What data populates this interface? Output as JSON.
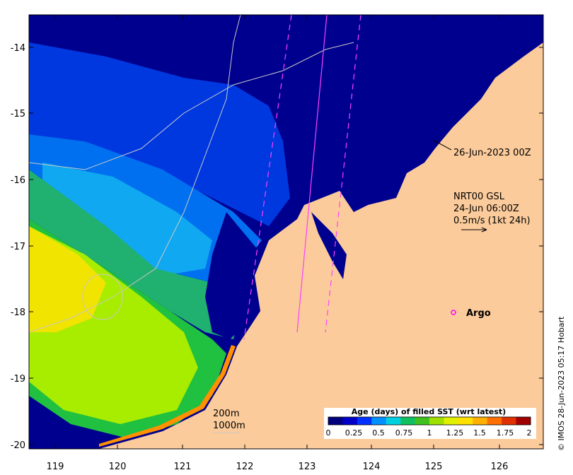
{
  "axes": {
    "x_ticks": [
      "119",
      "120",
      "121",
      "122",
      "123",
      "124",
      "125",
      "126"
    ],
    "y_ticks": [
      "-14",
      "-15",
      "-16",
      "-17",
      "-18",
      "-19",
      "-20"
    ]
  },
  "annotations": {
    "track_time": "26-Jun-2023 00Z",
    "current_source": "NRT00 GSL",
    "current_time": "24-Jun 06:00Z",
    "current_scale": "0.5m/s (1kt 24h)",
    "argo_label": "Argo"
  },
  "isobaths": {
    "label_200": "200m",
    "label_1000": "1000m"
  },
  "colorbar": {
    "title": "Age (days) of filled SST (wrt latest)",
    "ticks": [
      "0",
      "0.25",
      "0.5",
      "0.75",
      "1",
      "1.25",
      "1.5",
      "1.75",
      "2"
    ],
    "colors": [
      "#00007f",
      "#0000c8",
      "#0030ff",
      "#0090ff",
      "#00d0e0",
      "#10c060",
      "#40c020",
      "#a0e000",
      "#e0f000",
      "#ffe000",
      "#ffb000",
      "#ff7000",
      "#e03000",
      "#a00000"
    ]
  },
  "credit": "© IMOS 28-Jun-2023 05:17 Hobart",
  "colors": {
    "land": "#fbcb9b",
    "deep": "#00008e",
    "ocean_blue": "#0040f0",
    "ocean_light": "#10a0f0",
    "ocean_green": "#20c060",
    "ocean_lime": "#a8f000",
    "ocean_yellow": "#f0e800",
    "coast_orange": "#ff9000",
    "argo": "#ff00ff"
  }
}
